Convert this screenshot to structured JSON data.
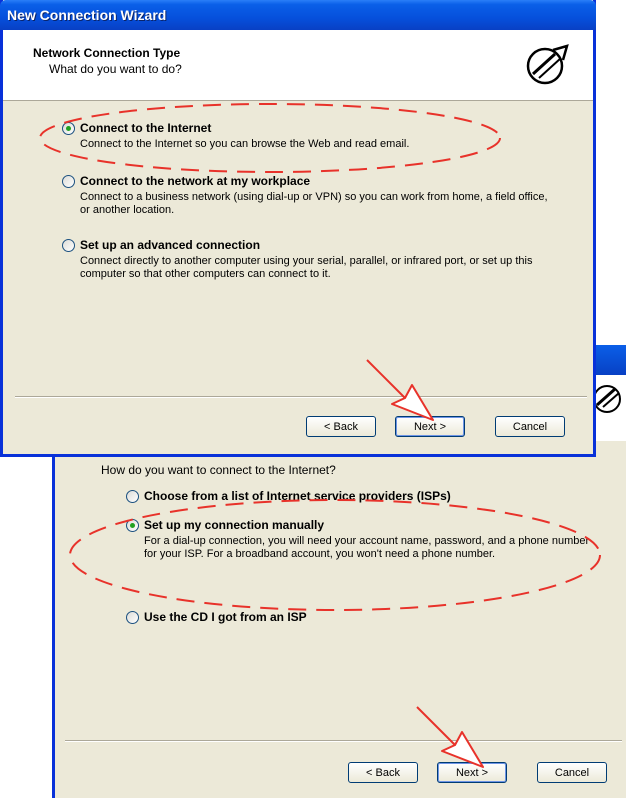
{
  "window1": {
    "title": "New Connection Wizard",
    "header_title": "Network Connection Type",
    "header_subtitle": "What do you want to do?",
    "options": [
      {
        "label": "Connect to the Internet",
        "desc": "Connect to the Internet so you can browse the Web and read email.",
        "checked": true
      },
      {
        "label": "Connect to the network at my workplace",
        "desc": "Connect to a business network (using dial-up or VPN) so you can work from home, a field office, or another location.",
        "checked": false
      },
      {
        "label": "Set up an advanced connection",
        "desc": "Connect directly to another computer using your serial, parallel, or infrared port, or set up this computer so that other computers can connect to it.",
        "checked": false
      }
    ],
    "buttons": {
      "back": "< Back",
      "next": "Next >",
      "cancel": "Cancel"
    }
  },
  "window2": {
    "question": "How do you want to connect to the Internet?",
    "options": [
      {
        "label": "Choose from a list of Internet service providers (ISPs)",
        "desc": "",
        "checked": false
      },
      {
        "label": "Set up my connection manually",
        "desc": "For a dial-up connection, you will need your account name, password, and a phone number for your ISP. For a broadband account, you won't need a phone number.",
        "checked": true
      },
      {
        "label": "Use the CD I got from an ISP",
        "desc": "",
        "checked": false
      }
    ],
    "buttons": {
      "back": "< Back",
      "next": "Next >",
      "cancel": "Cancel"
    }
  },
  "annotations": {
    "color": "#e8322a",
    "arrow_color": "#e8322a"
  },
  "icons": {
    "header_icon": "network-connection-icon"
  }
}
